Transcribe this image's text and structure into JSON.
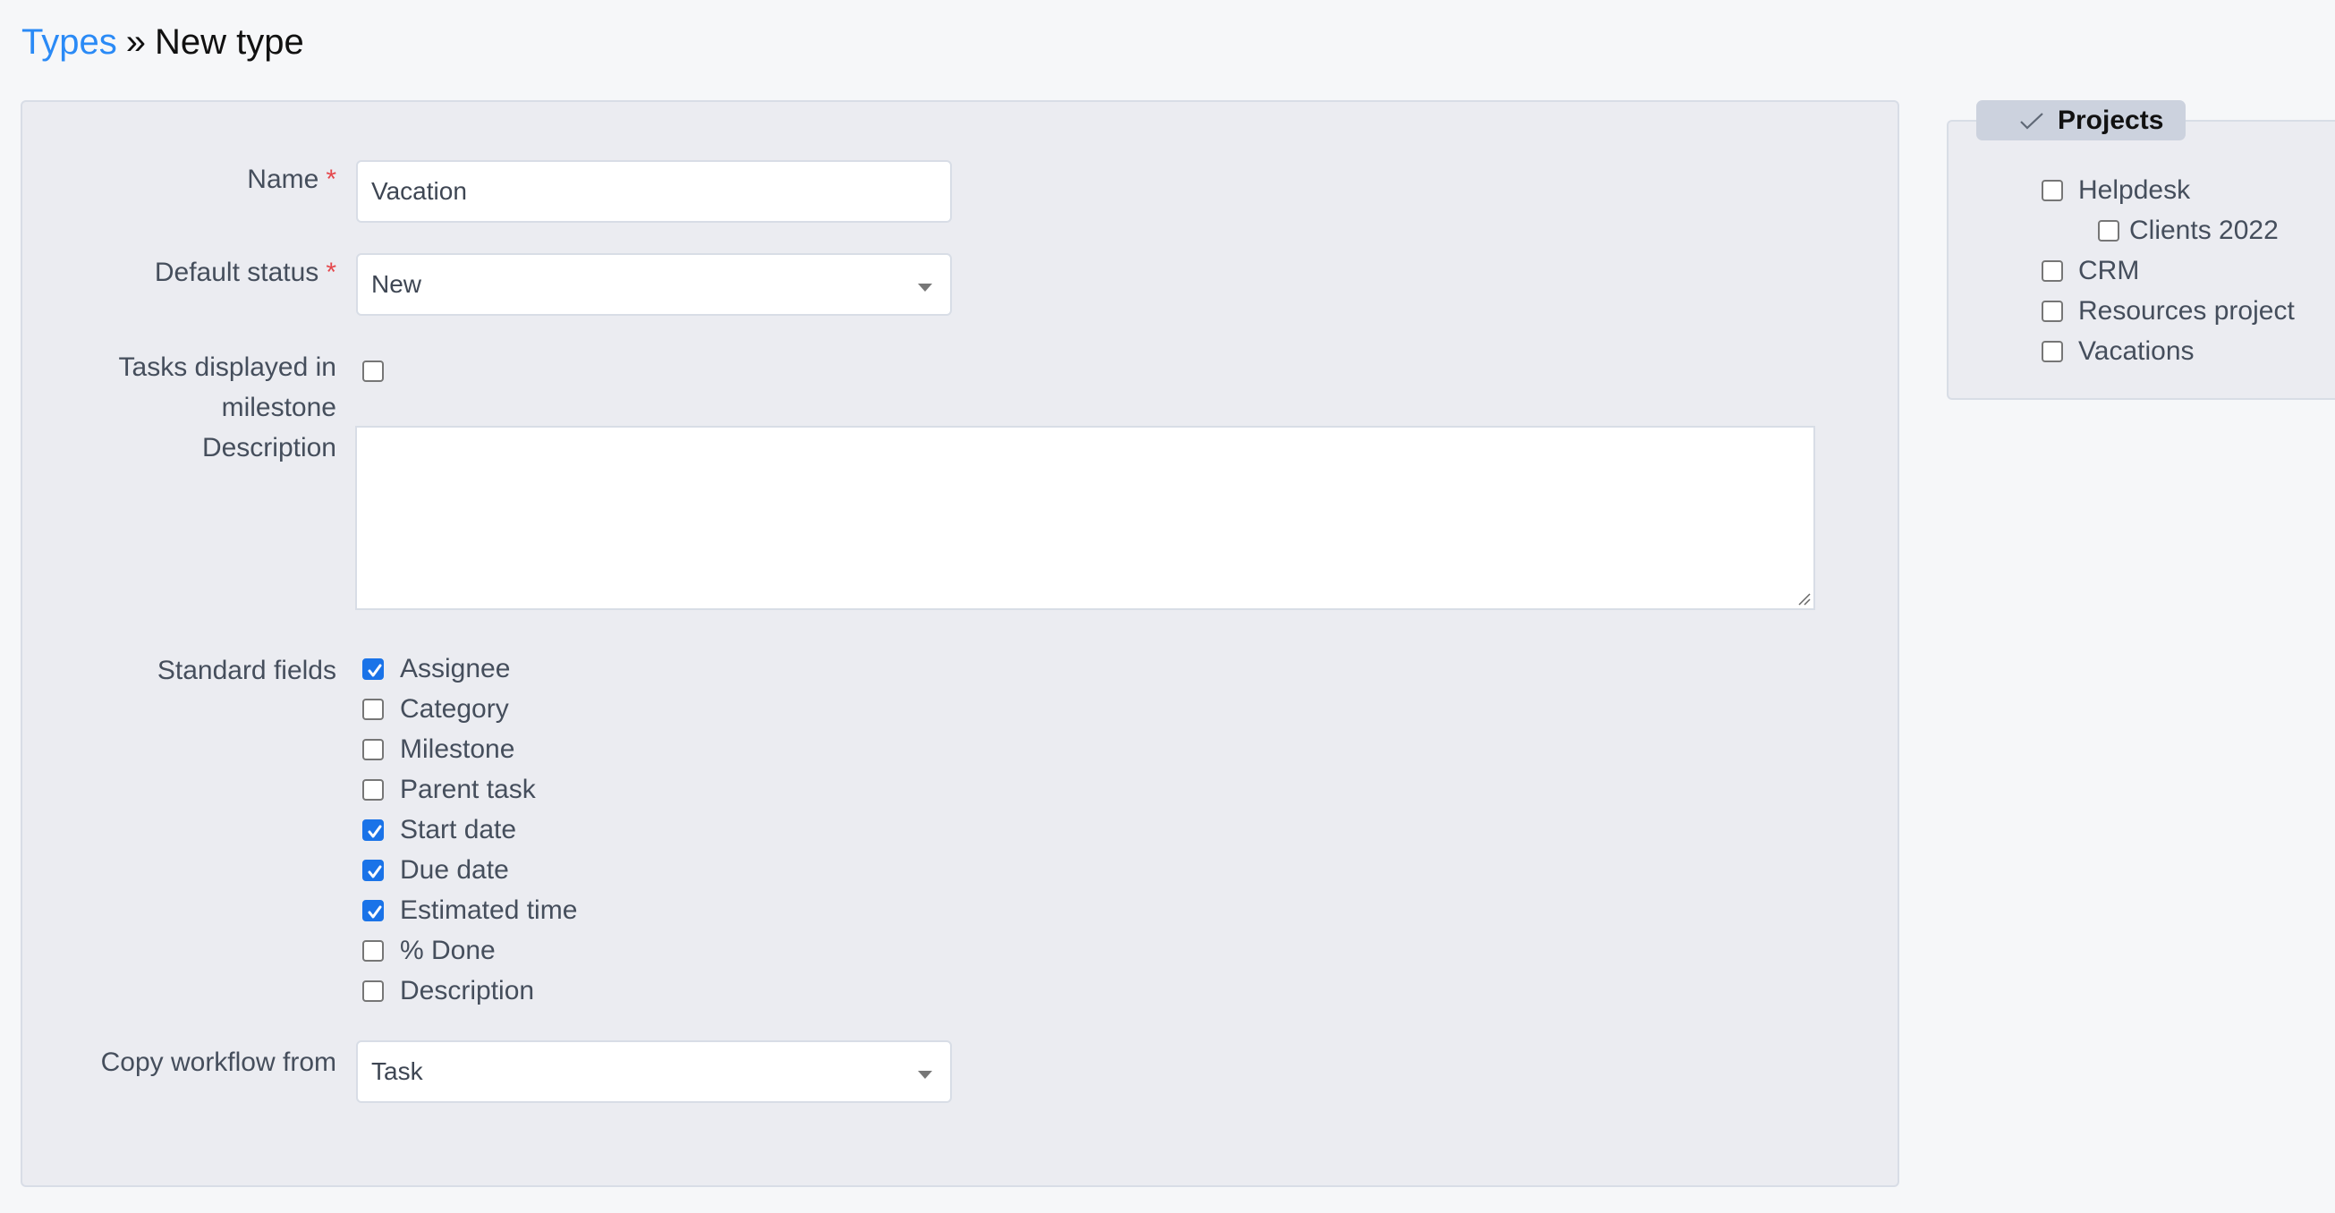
{
  "breadcrumb": {
    "parent_label": "Types",
    "separator": "»",
    "current_label": "New type"
  },
  "form": {
    "name": {
      "label": "Name",
      "required_marker": "*",
      "value": "Vacation"
    },
    "default_status": {
      "label": "Default status",
      "required_marker": "*",
      "value": "New"
    },
    "tasks_in_milestone": {
      "label_line1": "Tasks displayed in",
      "label_line2": "milestone",
      "checked": false
    },
    "description": {
      "label": "Description",
      "value": ""
    },
    "standard_fields": {
      "label": "Standard fields",
      "items": [
        {
          "label": "Assignee",
          "checked": true
        },
        {
          "label": "Category",
          "checked": false
        },
        {
          "label": "Milestone",
          "checked": false
        },
        {
          "label": "Parent task",
          "checked": false
        },
        {
          "label": "Start date",
          "checked": true
        },
        {
          "label": "Due date",
          "checked": true
        },
        {
          "label": "Estimated time",
          "checked": true
        },
        {
          "label": "% Done",
          "checked": false
        },
        {
          "label": "Description",
          "checked": false
        }
      ]
    },
    "copy_workflow": {
      "label": "Copy workflow from",
      "value": "Task"
    }
  },
  "projects": {
    "title": "Projects",
    "toggle_icon": "check-icon",
    "items": [
      {
        "label": "Helpdesk",
        "checked": false,
        "level": 0
      },
      {
        "label": "Clients 2022",
        "checked": false,
        "level": 1
      },
      {
        "label": "CRM",
        "checked": false,
        "level": 0
      },
      {
        "label": "Resources project",
        "checked": false,
        "level": 0
      },
      {
        "label": "Vacations",
        "checked": false,
        "level": 0
      }
    ]
  },
  "colors": {
    "link": "#2a8af6",
    "checkbox_checked": "#1a73e8",
    "required": "#e5484d",
    "panel_bg": "#ebecf1",
    "legend_bg": "#ccd2de"
  }
}
